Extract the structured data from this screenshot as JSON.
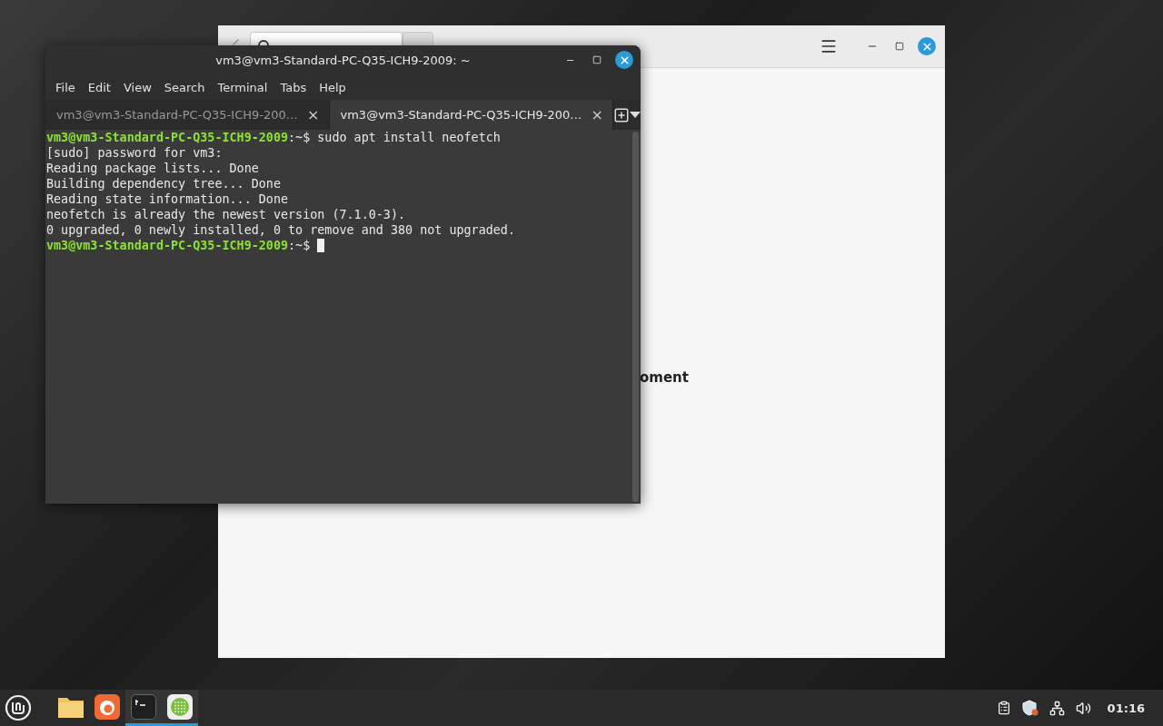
{
  "software_manager": {
    "message": "oment"
  },
  "terminal": {
    "title": "vm3@vm3-Standard-PC-Q35-ICH9-2009: ~",
    "menu": [
      "File",
      "Edit",
      "View",
      "Search",
      "Terminal",
      "Tabs",
      "Help"
    ],
    "tabs": [
      {
        "label": "vm3@vm3-Standard-PC-Q35-ICH9-200…",
        "close": "×",
        "selected": false
      },
      {
        "label": "vm3@vm3-Standard-PC-Q35-ICH9-200…",
        "close": "×",
        "selected": true
      }
    ],
    "lines": [
      {
        "kind": "prompt",
        "user": "vm3@vm3-Standard-PC-Q35-ICH9-2009",
        "path": ":~$",
        "command": "sudo apt install neofetch",
        "cursor": false
      },
      {
        "kind": "output",
        "text": "[sudo] password for vm3:"
      },
      {
        "kind": "output",
        "text": "Reading package lists... Done"
      },
      {
        "kind": "output",
        "text": "Building dependency tree... Done"
      },
      {
        "kind": "output",
        "text": "Reading state information... Done"
      },
      {
        "kind": "output",
        "text": "neofetch is already the newest version (7.1.0-3)."
      },
      {
        "kind": "output",
        "text": "0 upgraded, 0 newly installed, 0 to remove and 380 not upgraded."
      },
      {
        "kind": "prompt",
        "user": "vm3@vm3-Standard-PC-Q35-ICH9-2009",
        "path": ":~$",
        "cursor": true
      }
    ]
  },
  "taskbar": {
    "apps": [
      {
        "kind": "folder",
        "running": false
      },
      {
        "kind": "browser",
        "running": false
      },
      {
        "kind": "terminal",
        "running": true
      },
      {
        "kind": "apps",
        "running": true
      }
    ],
    "clock": "01:16"
  }
}
